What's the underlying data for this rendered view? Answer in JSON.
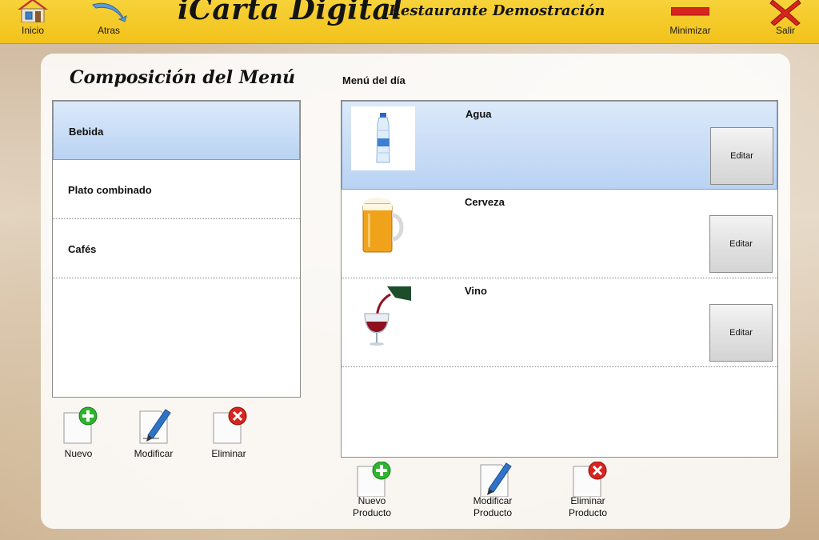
{
  "header": {
    "app_title": "iCarta Digital",
    "restaurant_name": "Restaurante Demostración",
    "buttons": {
      "home": "Inicio",
      "back": "Atras",
      "minimize": "Minimizar",
      "exit": "Salir"
    }
  },
  "categories_panel": {
    "title": "Composición del Menú",
    "items": [
      {
        "label": "Bebida",
        "selected": true
      },
      {
        "label": "Plato combinado",
        "selected": false
      },
      {
        "label": "Cafés",
        "selected": false
      }
    ],
    "actions": {
      "new": "Nuevo",
      "edit": "Modificar",
      "delete": "Eliminar"
    }
  },
  "products_panel": {
    "title": "Menú del día",
    "items": [
      {
        "name": "Agua",
        "image": "water-bottle-image",
        "edit_label": "Editar",
        "selected": true
      },
      {
        "name": "Cerveza",
        "image": "beer-mug-image",
        "edit_label": "Editar",
        "selected": false
      },
      {
        "name": "Vino",
        "image": "wine-pour-image",
        "edit_label": "Editar",
        "selected": false
      }
    ],
    "actions": {
      "new_line1": "Nuevo",
      "new_line2": "Producto",
      "edit_line1": "Modificar",
      "edit_line2": "Producto",
      "delete_line1": "Eliminar",
      "delete_line2": "Producto"
    }
  },
  "colors": {
    "header_yellow": "#f2c21a",
    "selection_blue": "#b9d3f3",
    "add_green": "#2fb52f",
    "delete_red": "#d8251f"
  }
}
